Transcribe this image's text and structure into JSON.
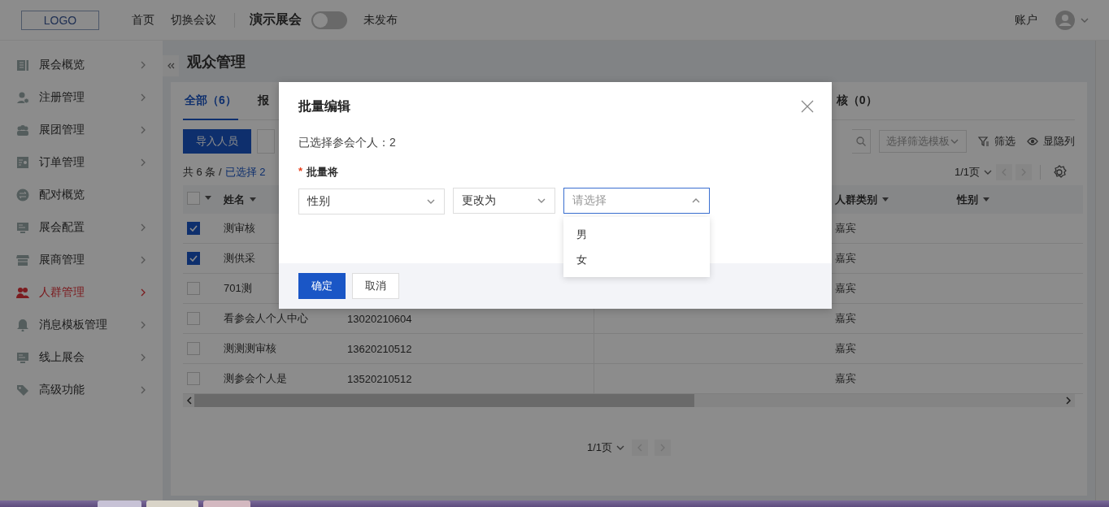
{
  "header": {
    "logo": "LOGO",
    "nav": [
      {
        "label": "首页"
      },
      {
        "label": "切换会议"
      }
    ],
    "event_title": "演示展会",
    "publish_toggle": {
      "on": false
    },
    "publish_status": "未发布",
    "account": "账户"
  },
  "sidebar": {
    "items": [
      {
        "label": "展会概览",
        "expandable": true,
        "selected": false
      },
      {
        "label": "注册管理",
        "expandable": true,
        "selected": false
      },
      {
        "label": "展团管理",
        "expandable": true,
        "selected": false
      },
      {
        "label": "订单管理",
        "expandable": true,
        "selected": false
      },
      {
        "label": "配对概览",
        "expandable": false,
        "selected": false
      },
      {
        "label": "展会配置",
        "expandable": true,
        "selected": false
      },
      {
        "label": "展商管理",
        "expandable": true,
        "selected": false
      },
      {
        "label": "人群管理",
        "expandable": true,
        "selected": true
      },
      {
        "label": "消息模板管理",
        "expandable": true,
        "selected": false
      },
      {
        "label": "线上展会",
        "expandable": true,
        "selected": false
      },
      {
        "label": "高级功能",
        "expandable": true,
        "selected": false
      }
    ]
  },
  "page_title": "观众管理",
  "tabs": [
    {
      "label": "全部（6）",
      "selected": true
    },
    {
      "label": "报",
      "selected": false
    },
    {
      "label": "核（0）",
      "selected": false
    }
  ],
  "toolbar": {
    "primary_button": "导入人员",
    "template_select": {
      "placeholder": "选择筛选模板"
    },
    "actions": [
      {
        "label": "筛选",
        "kind": "filter"
      },
      {
        "label": "显隐列",
        "kind": "columns"
      }
    ]
  },
  "summary": {
    "total": "共 6 条 /",
    "selected": "已选择 2"
  },
  "pager_top": "1/1页",
  "table": {
    "select_all": {
      "checked": false
    },
    "columns": [
      {
        "label": "姓名"
      },
      {
        "label": "人群类别"
      },
      {
        "label": "性别"
      }
    ],
    "rows": [
      {
        "checked": true,
        "name": "测审核",
        "group": "嘉宾"
      },
      {
        "checked": true,
        "name": "测供采",
        "group": "嘉宾"
      },
      {
        "checked": false,
        "name": "701测",
        "group": "嘉宾"
      },
      {
        "checked": false,
        "name": "看参会人个人中心",
        "phone": "13020210604",
        "group": "嘉宾"
      },
      {
        "checked": false,
        "name": "测测测审核",
        "phone": "13620210512",
        "group": "嘉宾"
      },
      {
        "checked": false,
        "name": "测参会个人是",
        "phone": "13520210512",
        "group": "嘉宾"
      }
    ]
  },
  "pager_bottom": "1/1页",
  "modal": {
    "title": "批量编辑",
    "selected_count": "已选择参会个人：2",
    "field_label": "批量将",
    "required_mark": "*",
    "field_select": {
      "value": "性别"
    },
    "action_select": {
      "value": "更改为"
    },
    "value_select": {
      "placeholder": "请选择",
      "expanded": true,
      "options": [
        {
          "label": "男",
          "selected": false
        },
        {
          "label": "女",
          "selected": false
        }
      ]
    },
    "buttons": [
      {
        "label": "确定",
        "kind": "primary"
      },
      {
        "label": "取消",
        "kind": "default"
      }
    ]
  }
}
